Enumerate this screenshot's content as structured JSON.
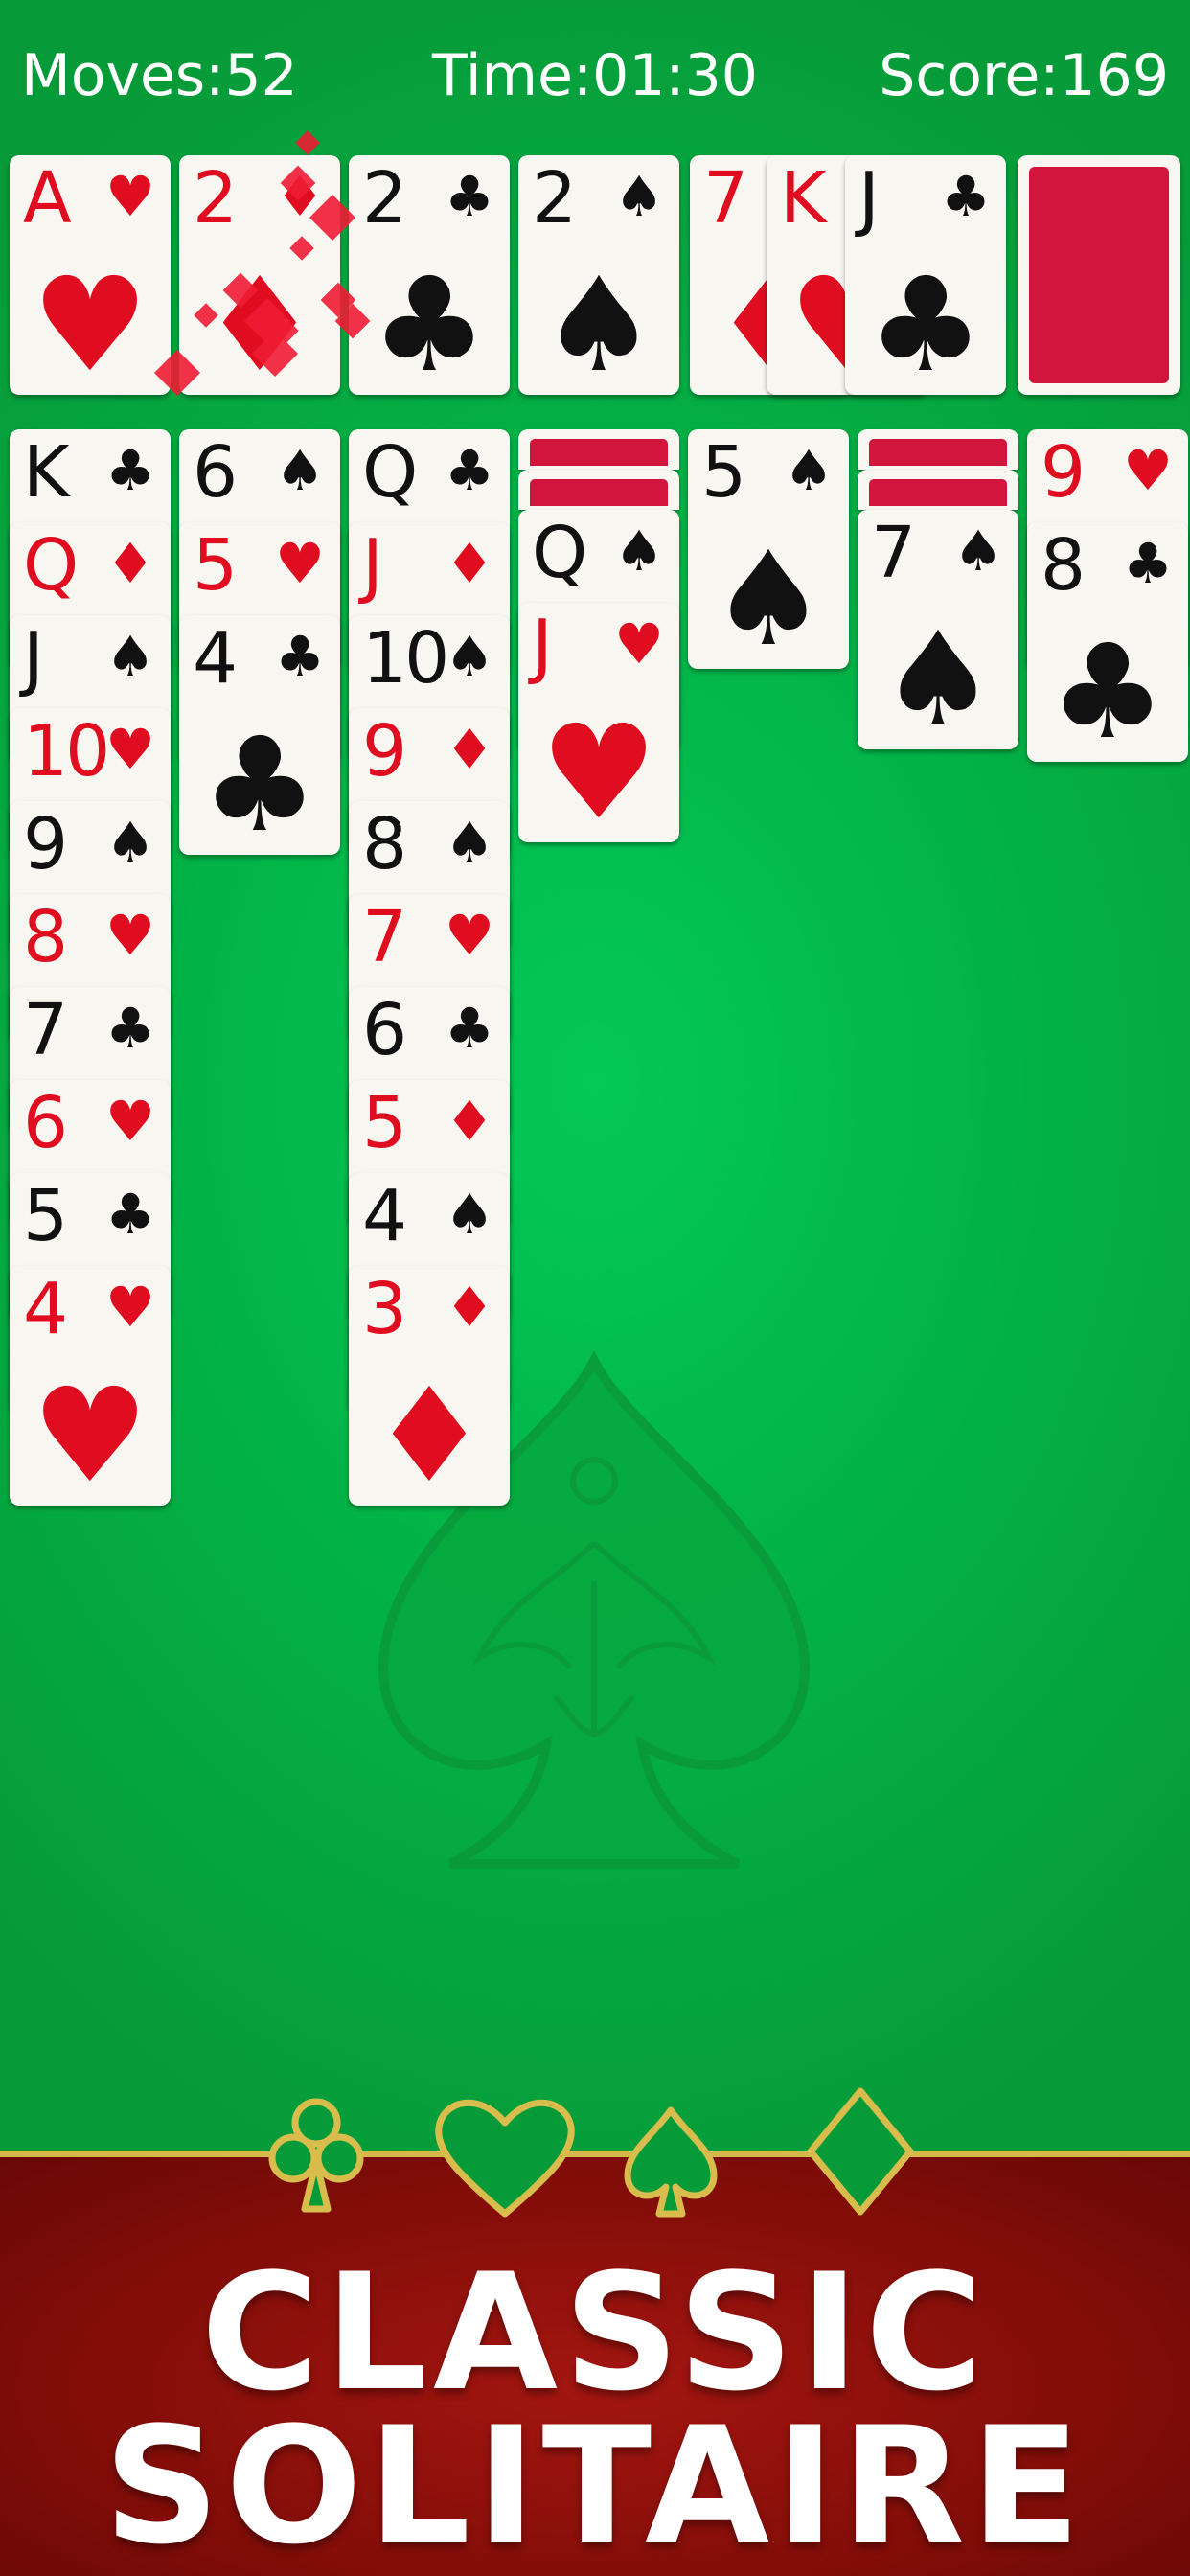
{
  "hud": {
    "moves": "Moves:52",
    "time": "Time:01:30",
    "score": "Score:169"
  },
  "colors": {
    "felt": "#02b447",
    "card_back": "#d2153d",
    "banner": "#7e0c08",
    "gold": "#d6b84a",
    "red_suit": "#e00d20"
  },
  "foundations": [
    {
      "rank": "A",
      "suit": "♥",
      "color": "red"
    },
    {
      "rank": "2",
      "suit": "♦",
      "color": "red"
    },
    {
      "rank": "2",
      "suit": "♣",
      "color": "black"
    },
    {
      "rank": "2",
      "suit": "♠",
      "color": "black"
    }
  ],
  "waste": [
    {
      "rank": "7",
      "suit": "♦",
      "color": "red"
    },
    {
      "rank": "K",
      "suit": "♥",
      "color": "red"
    },
    {
      "rank": "J",
      "suit": "♣",
      "color": "black"
    }
  ],
  "stock": {
    "state": "face-down"
  },
  "tableau": [
    {
      "hidden": 0,
      "cards": [
        {
          "rank": "K",
          "suit": "♣",
          "color": "black"
        },
        {
          "rank": "Q",
          "suit": "♦",
          "color": "red"
        },
        {
          "rank": "J",
          "suit": "♠",
          "color": "black"
        },
        {
          "rank": "10",
          "suit": "♥",
          "color": "red"
        },
        {
          "rank": "9",
          "suit": "♠",
          "color": "black"
        },
        {
          "rank": "8",
          "suit": "♥",
          "color": "red"
        },
        {
          "rank": "7",
          "suit": "♣",
          "color": "black"
        },
        {
          "rank": "6",
          "suit": "♥",
          "color": "red"
        },
        {
          "rank": "5",
          "suit": "♣",
          "color": "black"
        },
        {
          "rank": "4",
          "suit": "♥",
          "color": "red"
        }
      ]
    },
    {
      "hidden": 0,
      "cards": [
        {
          "rank": "6",
          "suit": "♠",
          "color": "black"
        },
        {
          "rank": "5",
          "suit": "♥",
          "color": "red"
        },
        {
          "rank": "4",
          "suit": "♣",
          "color": "black"
        }
      ]
    },
    {
      "hidden": 0,
      "cards": [
        {
          "rank": "Q",
          "suit": "♣",
          "color": "black"
        },
        {
          "rank": "J",
          "suit": "♦",
          "color": "red"
        },
        {
          "rank": "10",
          "suit": "♠",
          "color": "black"
        },
        {
          "rank": "9",
          "suit": "♦",
          "color": "red"
        },
        {
          "rank": "8",
          "suit": "♠",
          "color": "black"
        },
        {
          "rank": "7",
          "suit": "♥",
          "color": "red"
        },
        {
          "rank": "6",
          "suit": "♣",
          "color": "black"
        },
        {
          "rank": "5",
          "suit": "♦",
          "color": "red"
        },
        {
          "rank": "4",
          "suit": "♠",
          "color": "black"
        },
        {
          "rank": "3",
          "suit": "♦",
          "color": "red"
        }
      ]
    },
    {
      "hidden": 2,
      "cards": [
        {
          "rank": "Q",
          "suit": "♠",
          "color": "black"
        },
        {
          "rank": "J",
          "suit": "♥",
          "color": "red"
        }
      ]
    },
    {
      "hidden": 0,
      "cards": [
        {
          "rank": "5",
          "suit": "♠",
          "color": "black"
        }
      ]
    },
    {
      "hidden": 2,
      "cards": [
        {
          "rank": "7",
          "suit": "♠",
          "color": "black"
        }
      ]
    },
    {
      "hidden": 0,
      "cards": [
        {
          "rank": "9",
          "suit": "♥",
          "color": "red"
        },
        {
          "rank": "8",
          "suit": "♣",
          "color": "black"
        }
      ]
    }
  ],
  "banner": {
    "suits": [
      "club-icon",
      "heart-icon",
      "spade-icon",
      "diamond-icon"
    ],
    "line1": "CLASSIC",
    "line2": "SOLITAIRE"
  }
}
